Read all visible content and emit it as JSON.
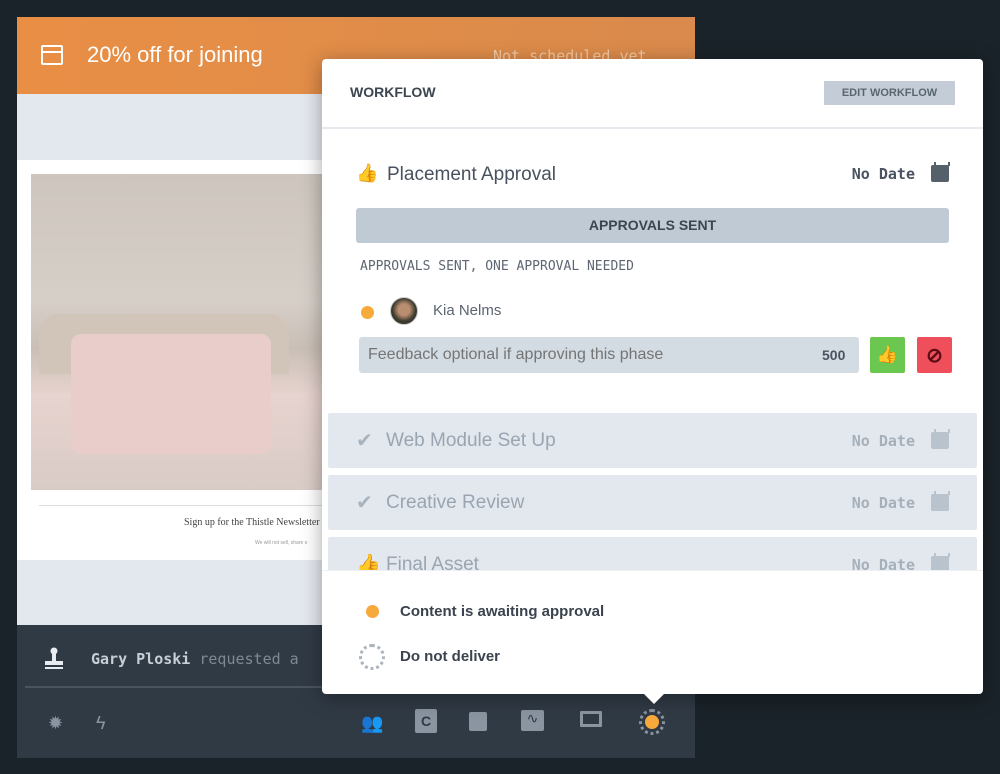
{
  "campaign": {
    "title": "20% off for joining",
    "schedule": "Not scheduled yet",
    "newsletter_text": "Sign up for the Thistle Newsletter",
    "fine_print": "We will not sell, share o"
  },
  "activity": {
    "user": "Gary Ploski",
    "action": "requested a"
  },
  "workflow": {
    "title": "WORKFLOW",
    "edit_label": "EDIT WORKFLOW",
    "active_stage": {
      "name": "Placement Approval",
      "date": "No Date",
      "status_bar": "APPROVALS SENT",
      "status_detail": "APPROVALS SENT, ONE APPROVAL NEEDED",
      "approver": "Kia Nelms",
      "feedback_placeholder": "Feedback optional if approving this phase",
      "char_count": "500"
    },
    "stages": [
      {
        "name": "Web Module Set Up",
        "date": "No Date",
        "icon": "check-icon"
      },
      {
        "name": "Creative Review",
        "date": "No Date",
        "icon": "check-icon"
      },
      {
        "name": "Final Asset",
        "date": "No Date",
        "icon": "thumbs-up-icon"
      }
    ],
    "legend": [
      {
        "label": "Content is awaiting approval",
        "icon": "orange-dot"
      },
      {
        "label": "Do not deliver",
        "icon": "dotted-ring"
      }
    ]
  },
  "colors": {
    "header": "#e98f45",
    "pending": "#f7a93c",
    "approve": "#6bc74f",
    "reject": "#ee4f5b"
  }
}
